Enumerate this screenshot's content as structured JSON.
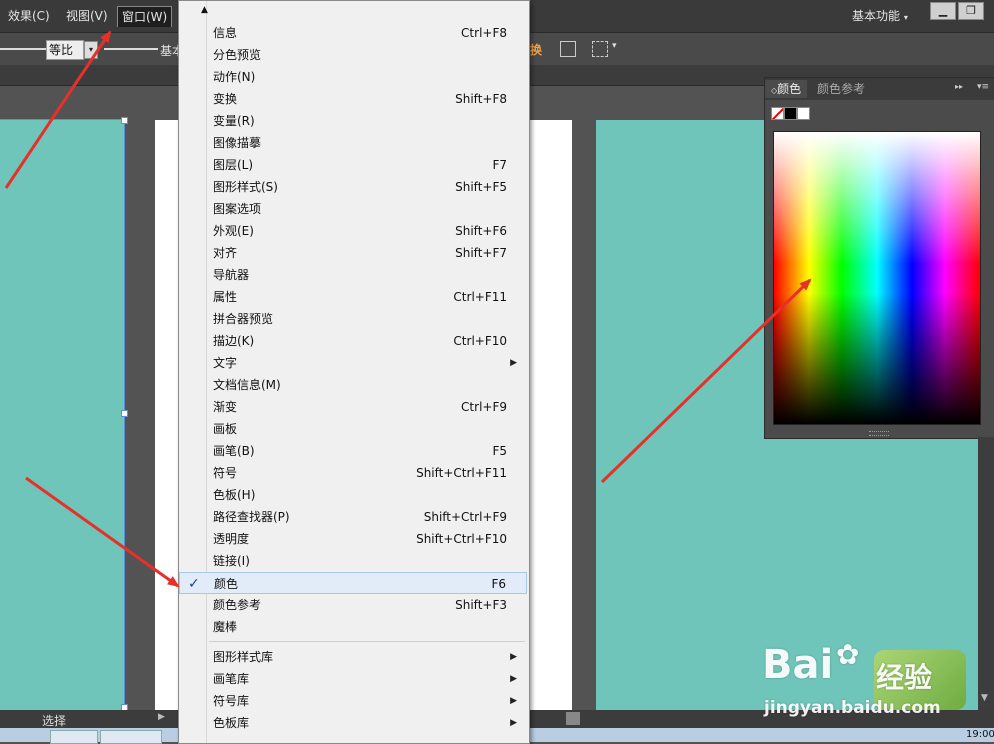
{
  "menubar": {
    "items": [
      "效果(C)",
      "视图(V)",
      "窗口(W)"
    ],
    "workspace": "基本功能"
  },
  "controlbar": {
    "stroke_ratio": "等比",
    "basic": "基本",
    "transform_label": "换"
  },
  "window_menu": {
    "groups": [
      [
        {
          "label": "信息",
          "shortcut": "Ctrl+F8"
        },
        {
          "label": "分色预览",
          "shortcut": ""
        },
        {
          "label": "动作(N)",
          "shortcut": ""
        },
        {
          "label": "变换",
          "shortcut": "Shift+F8"
        },
        {
          "label": "变量(R)",
          "shortcut": ""
        },
        {
          "label": "图像描摹",
          "shortcut": ""
        },
        {
          "label": "图层(L)",
          "shortcut": "F7"
        },
        {
          "label": "图形样式(S)",
          "shortcut": "Shift+F5"
        },
        {
          "label": "图案选项",
          "shortcut": ""
        },
        {
          "label": "外观(E)",
          "shortcut": "Shift+F6"
        },
        {
          "label": "对齐",
          "shortcut": "Shift+F7"
        },
        {
          "label": "导航器",
          "shortcut": ""
        },
        {
          "label": "属性",
          "shortcut": "Ctrl+F11"
        },
        {
          "label": "拼合器预览",
          "shortcut": ""
        },
        {
          "label": "描边(K)",
          "shortcut": "Ctrl+F10"
        },
        {
          "label": "文字",
          "shortcut": "",
          "submenu": true
        },
        {
          "label": "文档信息(M)",
          "shortcut": ""
        },
        {
          "label": "渐变",
          "shortcut": "Ctrl+F9"
        },
        {
          "label": "画板",
          "shortcut": ""
        },
        {
          "label": "画笔(B)",
          "shortcut": "F5"
        },
        {
          "label": "符号",
          "shortcut": "Shift+Ctrl+F11"
        },
        {
          "label": "色板(H)",
          "shortcut": ""
        },
        {
          "label": "路径查找器(P)",
          "shortcut": "Shift+Ctrl+F9"
        },
        {
          "label": "透明度",
          "shortcut": "Shift+Ctrl+F10"
        },
        {
          "label": "链接(I)",
          "shortcut": ""
        },
        {
          "label": "颜色",
          "shortcut": "F6",
          "checked": true
        },
        {
          "label": "颜色参考",
          "shortcut": "Shift+F3"
        },
        {
          "label": "魔棒",
          "shortcut": ""
        }
      ],
      [
        {
          "label": "图形样式库",
          "shortcut": "",
          "submenu": true
        },
        {
          "label": "画笔库",
          "shortcut": "",
          "submenu": true
        },
        {
          "label": "符号库",
          "shortcut": "",
          "submenu": true
        },
        {
          "label": "色板库",
          "shortcut": "",
          "submenu": true
        }
      ]
    ]
  },
  "color_panel": {
    "tabs": [
      "颜色",
      "颜色参考"
    ]
  },
  "statusbar": {
    "tool": "选择"
  },
  "taskbar": {
    "time": "19:00"
  },
  "watermark": {
    "brand": "Bai",
    "brand2": "经验",
    "url": "jingyan.baidu.com"
  },
  "colors": {
    "artboard": "#6fc5b9",
    "arrow": "#e8302a",
    "check": "#1f3f8f"
  }
}
